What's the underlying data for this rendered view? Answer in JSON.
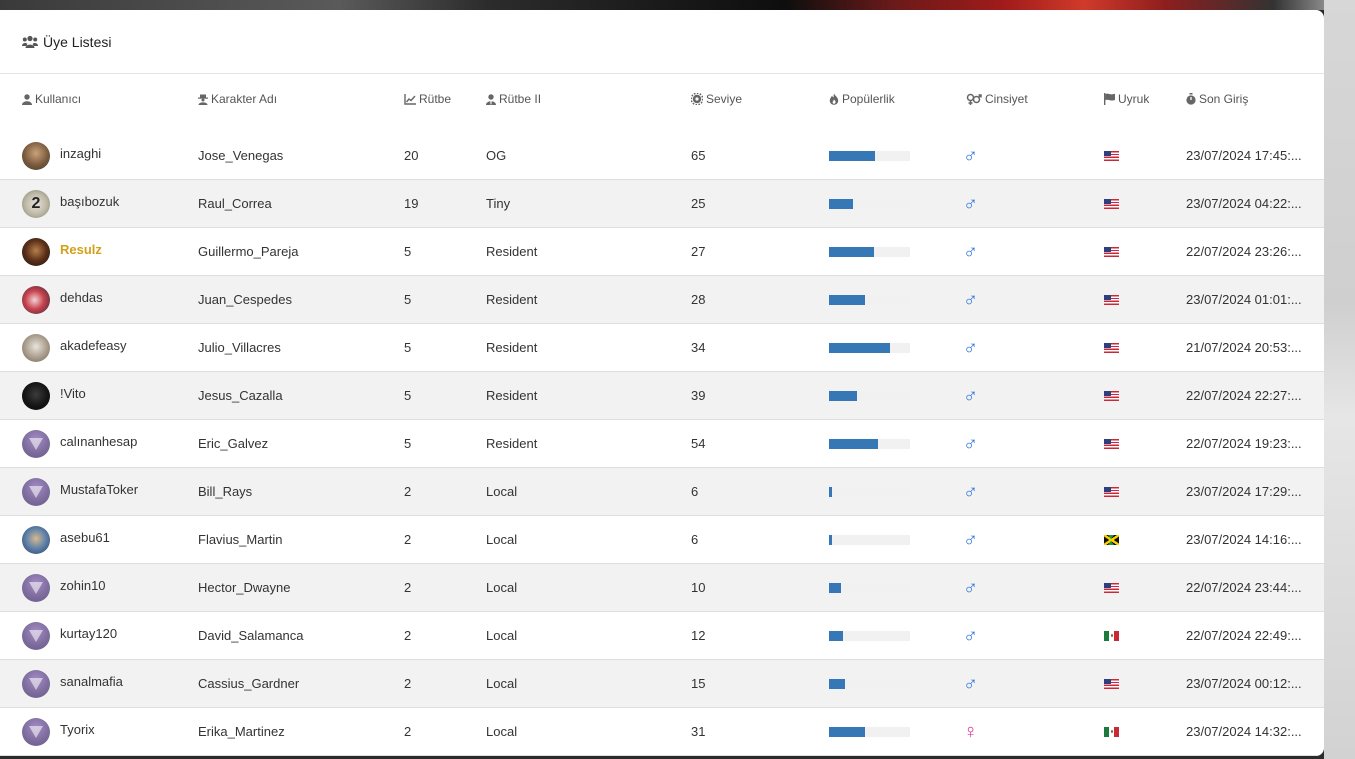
{
  "panel": {
    "title": "Üye Listesi",
    "icon": "users-icon"
  },
  "columns": [
    {
      "label": "Kullanıcı",
      "icon": "user-icon"
    },
    {
      "label": "Karakter Adı",
      "icon": "detective-icon"
    },
    {
      "label": "Rütbe",
      "icon": "chart-line-icon"
    },
    {
      "label": "Rütbe II",
      "icon": "user-tie-icon"
    },
    {
      "label": "Seviye",
      "icon": "gear-icon"
    },
    {
      "label": "Popülerlik",
      "icon": "fire-icon"
    },
    {
      "label": "Cinsiyet",
      "icon": "gender-icon"
    },
    {
      "label": "Uyruk",
      "icon": "flag-icon"
    },
    {
      "label": "Son Giriş",
      "icon": "stopwatch-icon"
    }
  ],
  "colors": {
    "bar_fill": "#3677b6",
    "male": "#2f7ad8",
    "female": "#e0389a",
    "highlight_user": "#d5a019"
  },
  "members": [
    {
      "user": "inzaghi",
      "avatar": "photo",
      "character": "Jose_Venegas",
      "rank": "20",
      "rank2": "OG",
      "level": "65",
      "popularity": 0.57,
      "gender": "male",
      "nationality": "us",
      "last_login": "23/07/2024 17:45:..."
    },
    {
      "user": "başıbozuk",
      "avatar": "number-2",
      "character": "Raul_Correa",
      "rank": "19",
      "rank2": "Tiny",
      "level": "25",
      "popularity": 0.3,
      "gender": "male",
      "nationality": "us",
      "last_login": "23/07/2024 04:22:..."
    },
    {
      "user": "Resulz",
      "avatar": "photo-dark",
      "highlight": true,
      "character": "Guillermo_Pareja",
      "rank": "5",
      "rank2": "Resident",
      "level": "27",
      "popularity": 0.56,
      "gender": "male",
      "nationality": "us",
      "last_login": "22/07/2024 23:26:..."
    },
    {
      "user": "dehdas",
      "avatar": "anime",
      "character": "Juan_Cespedes",
      "rank": "5",
      "rank2": "Resident",
      "level": "28",
      "popularity": 0.45,
      "gender": "male",
      "nationality": "us",
      "last_login": "23/07/2024 01:01:..."
    },
    {
      "user": "akadefeasy",
      "avatar": "photo-light",
      "character": "Julio_Villacres",
      "rank": "5",
      "rank2": "Resident",
      "level": "34",
      "popularity": 0.75,
      "gender": "male",
      "nationality": "us",
      "last_login": "21/07/2024 20:53:..."
    },
    {
      "user": "!Vito",
      "avatar": "photo-black",
      "character": "Jesus_Cazalla",
      "rank": "5",
      "rank2": "Resident",
      "level": "39",
      "popularity": 0.35,
      "gender": "male",
      "nationality": "us",
      "last_login": "22/07/2024 22:27:..."
    },
    {
      "user": "calınanhesap",
      "avatar": "default",
      "character": "Eric_Galvez",
      "rank": "5",
      "rank2": "Resident",
      "level": "54",
      "popularity": 0.6,
      "gender": "male",
      "nationality": "us",
      "last_login": "22/07/2024 19:23:..."
    },
    {
      "user": "MustafaToker",
      "avatar": "default",
      "character": "Bill_Rays",
      "rank": "2",
      "rank2": "Local",
      "level": "6",
      "popularity": 0.04,
      "gender": "male",
      "nationality": "us",
      "last_login": "23/07/2024 17:29:..."
    },
    {
      "user": "asebu61",
      "avatar": "photo-blue",
      "character": "Flavius_Martin",
      "rank": "2",
      "rank2": "Local",
      "level": "6",
      "popularity": 0.04,
      "gender": "male",
      "nationality": "jm",
      "last_login": "23/07/2024 14:16:..."
    },
    {
      "user": "zohin10",
      "avatar": "default",
      "character": "Hector_Dwayne",
      "rank": "2",
      "rank2": "Local",
      "level": "10",
      "popularity": 0.15,
      "gender": "male",
      "nationality": "us",
      "last_login": "22/07/2024 23:44:..."
    },
    {
      "user": "kurtay120",
      "avatar": "default",
      "character": "David_Salamanca",
      "rank": "2",
      "rank2": "Local",
      "level": "12",
      "popularity": 0.17,
      "gender": "male",
      "nationality": "mx",
      "last_login": "22/07/2024 22:49:..."
    },
    {
      "user": "sanalmafia",
      "avatar": "default",
      "character": "Cassius_Gardner",
      "rank": "2",
      "rank2": "Local",
      "level": "15",
      "popularity": 0.2,
      "gender": "male",
      "nationality": "us",
      "last_login": "23/07/2024 00:12:..."
    },
    {
      "user": "Tyorix",
      "avatar": "default",
      "character": "Erika_Martinez",
      "rank": "2",
      "rank2": "Local",
      "level": "31",
      "popularity": 0.45,
      "gender": "female",
      "nationality": "mx",
      "last_login": "23/07/2024 14:32:..."
    }
  ]
}
